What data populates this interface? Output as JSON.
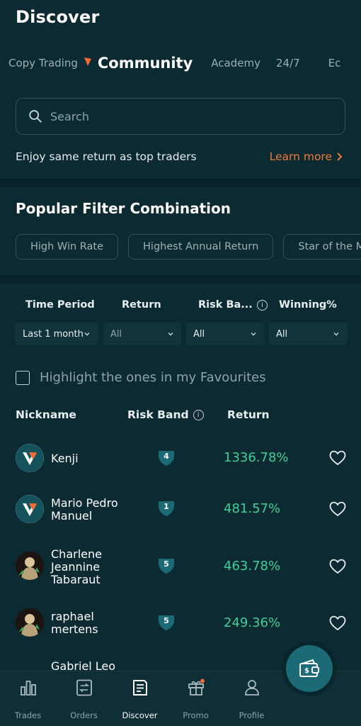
{
  "header": {
    "title": "Discover"
  },
  "tabs": [
    {
      "label": "Copy Trading",
      "active": false
    },
    {
      "label": "Community",
      "active": true
    },
    {
      "label": "Academy",
      "active": false
    },
    {
      "label": "24/7",
      "active": false
    },
    {
      "label": "Ec",
      "active": false
    }
  ],
  "search": {
    "placeholder": "Search",
    "value": ""
  },
  "promo": {
    "text": "Enjoy same return as top traders",
    "link": "Learn more"
  },
  "popular": {
    "title": "Popular Filter Combination",
    "chips": [
      "High Win Rate",
      "Highest Annual Return",
      "Star of the M"
    ]
  },
  "filters": {
    "headers": {
      "time_period": "Time Period",
      "return": "Return",
      "risk_band": "Risk Ba...",
      "winning": "Winning%"
    },
    "values": {
      "time_period": "Last 1 month",
      "return": "All",
      "risk_band": "All",
      "winning": "All"
    }
  },
  "favourites": {
    "label": "Highlight the ones in my Favourites",
    "checked": false
  },
  "table": {
    "headers": {
      "nickname": "Nickname",
      "risk_band": "Risk Band",
      "return": "Return"
    },
    "rows": [
      {
        "avatar": "v-logo",
        "name_lines": [
          "Kenji"
        ],
        "risk_band": "4",
        "return": "1336.78%"
      },
      {
        "avatar": "v-logo",
        "name_lines": [
          "Mario Pedro",
          "Manuel"
        ],
        "risk_band": "1",
        "return": "481.57%"
      },
      {
        "avatar": "photo",
        "name_lines": [
          "Charlene",
          "Jeannine",
          "Tabaraut"
        ],
        "risk_band": "5",
        "return": "463.78%"
      },
      {
        "avatar": "photo",
        "name_lines": [
          "raphael",
          "mertens"
        ],
        "risk_band": "5",
        "return": "249.36%"
      }
    ],
    "partial_row": "Gabriel Leo"
  },
  "bottom_nav": [
    {
      "label": "Trades",
      "icon": "bar-chart-icon",
      "active": false
    },
    {
      "label": "Orders",
      "icon": "orders-icon",
      "active": false
    },
    {
      "label": "Discover",
      "icon": "discover-icon",
      "active": true
    },
    {
      "label": "Promo",
      "icon": "gift-icon",
      "active": false,
      "dot": true
    },
    {
      "label": "Profile",
      "icon": "user-icon",
      "active": false
    }
  ],
  "colors": {
    "background": "#0b2a31",
    "accent_orange": "#f07b3a",
    "return_green": "#3fcf9a",
    "badge_teal": "#1b6a76"
  }
}
